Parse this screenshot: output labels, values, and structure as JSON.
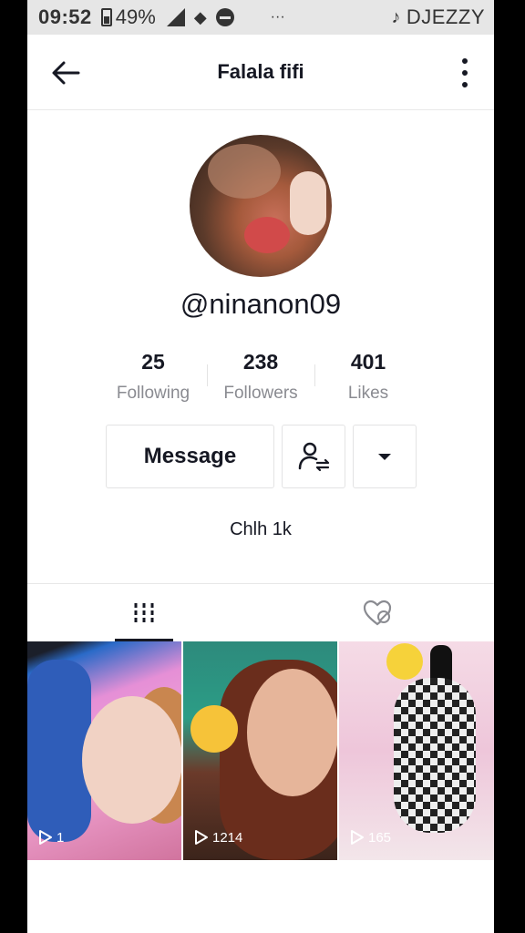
{
  "status_bar": {
    "time": "09:52",
    "battery": "49%",
    "dots": "···",
    "carrier": "DJEZZY"
  },
  "header": {
    "title": "Falala fifi"
  },
  "profile": {
    "username": "@ninanon09",
    "stats": [
      {
        "value": "25",
        "label": "Following"
      },
      {
        "value": "238",
        "label": "Followers"
      },
      {
        "value": "401",
        "label": "Likes"
      }
    ],
    "message_label": "Message",
    "bio": "Chlh 1k"
  },
  "tabs": {
    "videos_icon": "grid-icon",
    "liked_icon": "heart-hidden-icon",
    "active": "videos"
  },
  "videos": [
    {
      "views": "1"
    },
    {
      "views": "1214"
    },
    {
      "views": "165"
    }
  ],
  "colors": {
    "text": "#161823",
    "muted": "#8a8b91",
    "border": "#e3e3e4"
  }
}
